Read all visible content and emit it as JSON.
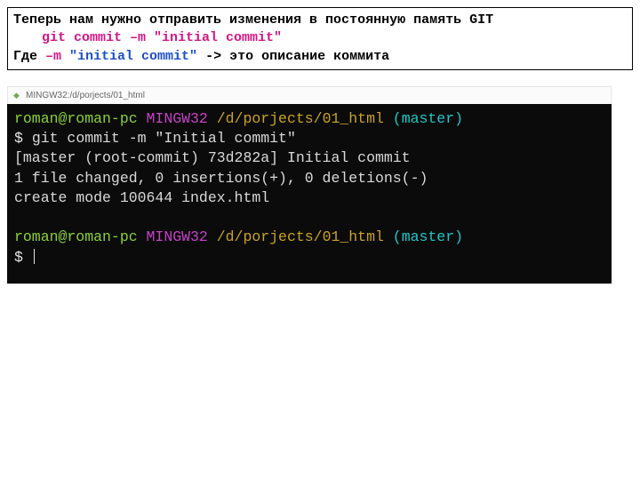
{
  "info": {
    "line1": "Теперь нам нужно отправить изменения в постоянную память GIT",
    "command": "git commit –m  \"initial commit\"",
    "line3_a": "Где ",
    "line3_flag": "–m ",
    "line3_msg": "\"initial commit\"",
    "line3_b": "  -> это описание коммита"
  },
  "titlebar": {
    "icon": "◆",
    "text": "MINGW32:/d/porjects/01_html"
  },
  "terminal": {
    "user": "roman@roman-pc",
    "host": " MINGW32",
    "path": " /d/porjects/01_html",
    "branch": " (master)",
    "prompt": "$ ",
    "cmd1": "git commit -m \"Initial commit\"",
    "out1": "[master (root-commit) 73d282a] Initial commit",
    "out2": " 1 file changed, 0 insertions(+), 0 deletions(-)",
    "out3": " create mode 100644 index.html"
  }
}
